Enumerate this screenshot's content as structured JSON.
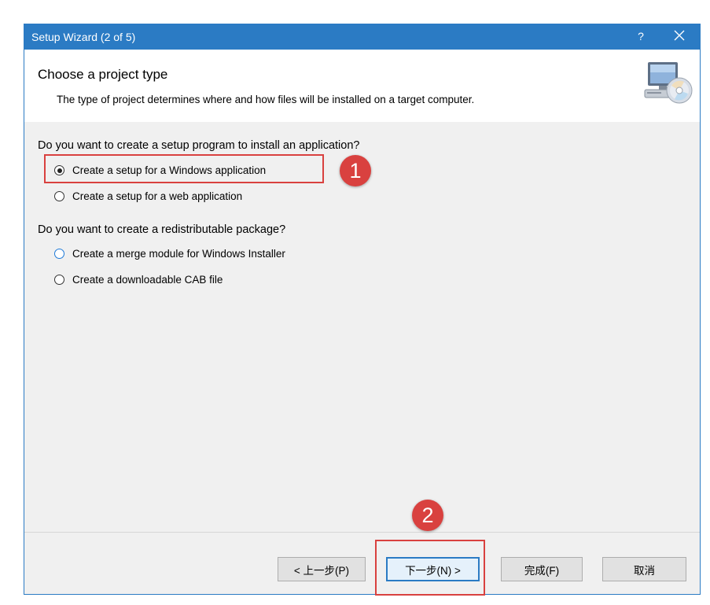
{
  "window": {
    "title": "Setup Wizard (2 of 5)",
    "help_glyph": "?",
    "close_glyph": "✕"
  },
  "header": {
    "title": "Choose a project type",
    "description": "The type of project determines where and how files will be installed on a target computer.",
    "icon": "setup-computer-cd-icon"
  },
  "section1": {
    "question": "Do you want to create a setup program to install an application?",
    "options": [
      {
        "label": "Create a setup for a Windows application",
        "selected": true
      },
      {
        "label": "Create a setup for a web application",
        "selected": false
      }
    ]
  },
  "section2": {
    "question": "Do you want to create a redistributable package?",
    "options": [
      {
        "label": "Create a merge module for Windows Installer",
        "selected": false
      },
      {
        "label": "Create a downloadable CAB file",
        "selected": false
      }
    ]
  },
  "footer": {
    "back_label": "< 上一步(P)",
    "next_label": "下一步(N) >",
    "finish_label": "完成(F)",
    "cancel_label": "取消"
  },
  "annotations": {
    "badge1": "1",
    "badge2": "2",
    "color": "#d9413f"
  },
  "colors": {
    "titlebar": "#2b7bc4",
    "body": "#f0f0f0"
  }
}
